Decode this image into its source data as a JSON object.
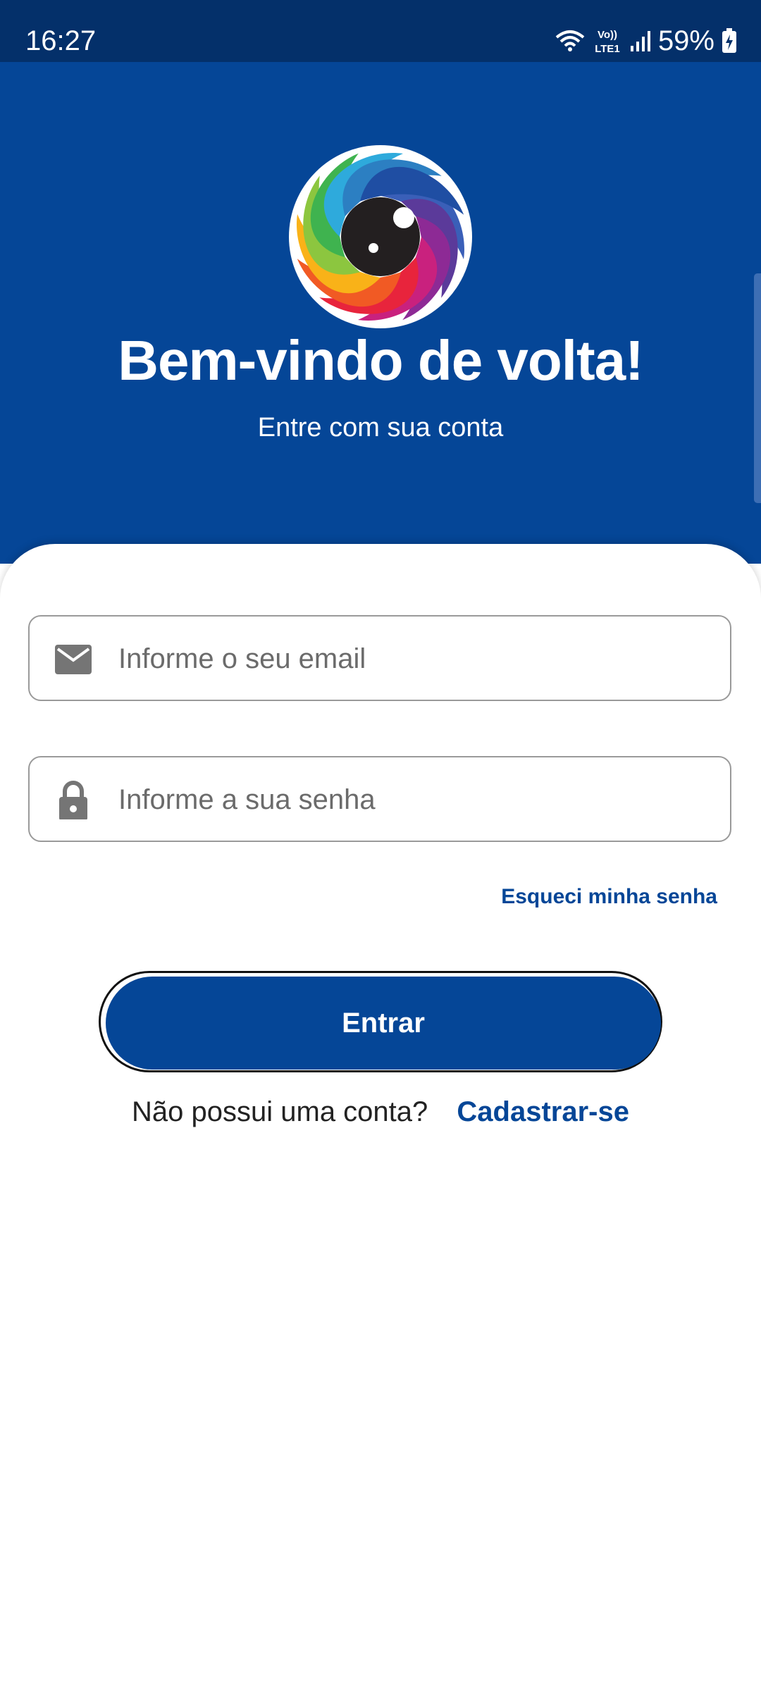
{
  "status_bar": {
    "time": "16:27",
    "network_label_top": "Vo))",
    "network_label_bottom": "LTE1",
    "battery": "59%",
    "icons": [
      "wifi-icon",
      "volte-lte-icon",
      "signal-icon",
      "battery-charging-icon"
    ]
  },
  "header": {
    "logo": "eye-logo",
    "title": "Bem-vindo de volta!",
    "subtitle": "Entre com sua conta"
  },
  "form": {
    "email": {
      "icon": "mail-icon",
      "value": "",
      "placeholder": "Informe o seu email"
    },
    "password": {
      "icon": "lock-icon",
      "value": "",
      "placeholder": "Informe a sua senha"
    },
    "forgot_label": "Esqueci minha senha",
    "submit_label": "Entrar"
  },
  "signup": {
    "question": "Não possui uma conta?",
    "link_label": "Cadastrar-se"
  },
  "colors": {
    "primary": "#054697",
    "status_bar": "#04306a",
    "background": "#ffffff"
  }
}
